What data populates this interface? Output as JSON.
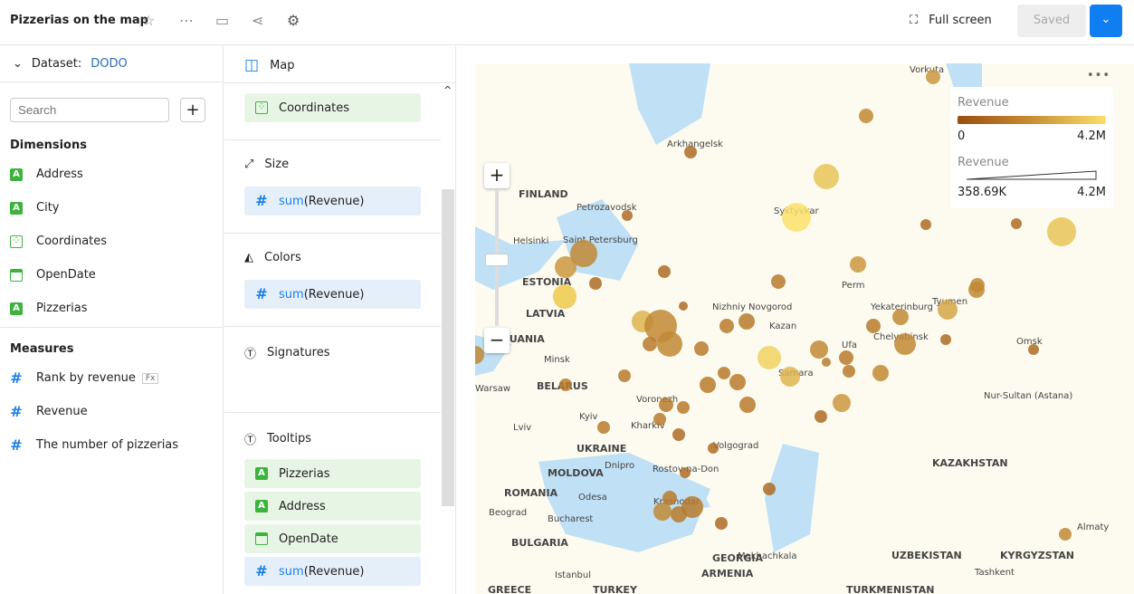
{
  "header": {
    "title": "Pizzerias on the map",
    "fullscreen": "Full screen",
    "saved": "Saved"
  },
  "dataset": {
    "label": "Dataset:",
    "name": "DODO"
  },
  "search": {
    "placeholder": "Search"
  },
  "dimensions": {
    "title": "Dimensions",
    "items": [
      {
        "label": "Address",
        "type": "string"
      },
      {
        "label": "City",
        "type": "string"
      },
      {
        "label": "Coordinates",
        "type": "geo"
      },
      {
        "label": "OpenDate",
        "type": "date"
      },
      {
        "label": "Pizzerias",
        "type": "string"
      }
    ]
  },
  "measures": {
    "title": "Measures",
    "items": [
      {
        "label": "Rank by revenue",
        "type": "number",
        "badge": "Fx"
      },
      {
        "label": "Revenue",
        "type": "number"
      },
      {
        "label": "The number of pizzerias",
        "type": "number"
      }
    ]
  },
  "vis": {
    "type": "Map",
    "coords": "Coordinates",
    "size": "Size",
    "size_fn": "sum",
    "size_field": "(Revenue)",
    "colors": "Colors",
    "colors_fn": "sum",
    "colors_field": "(Revenue)",
    "signatures": "Signatures",
    "tooltips": "Tooltips",
    "tooltip_items": [
      "Pizzerias",
      "Address",
      "OpenDate"
    ],
    "tooltip_fn": "sum",
    "tooltip_field": "(Revenue)"
  },
  "legend": {
    "color_title": "Revenue",
    "color_min": "0",
    "color_max": "4.2M",
    "size_title": "Revenue",
    "size_min": "358.69K",
    "size_max": "4.2M",
    "colors": [
      "#9a4e12",
      "#fbe06a"
    ]
  },
  "map_labels": [
    "Vorkuta",
    "Arkhangelsk",
    "FINLAND",
    "Petrozavodsk",
    "Syktyvkar",
    "Helsinki",
    "Saint Petersburg",
    "ESTONIA",
    "LATVIA",
    "Perm",
    "Nizhniy Novgorod",
    "Yekaterinburg",
    "Tyumen",
    "LITHUANIA",
    "Kazan",
    "Chelyabinsk",
    "Ufa",
    "Omsk",
    "Minsk",
    "BELARUS",
    "Warsaw",
    "Samara",
    "Voronezh",
    "Kyiv",
    "Kharkiv",
    "Lviv",
    "UKRAINE",
    "Volgograd",
    "Dnipro",
    "Rostov-na-Don",
    "MOLDOVA",
    "ROMANIA",
    "Odesa",
    "Krasnodar",
    "Beograd",
    "Bucharest",
    "BULGARIA",
    "Makhachkala",
    "GEORGIA",
    "Istanbul",
    "ARMENIA",
    "TURKEY",
    "GREECE",
    "KAZAKHSTAN",
    "Nur-Sultan (Astana)",
    "UZBEKISTAN",
    "KYRGYZSTAN",
    "Tashkent",
    "TURKMENISTAN",
    "Almaty"
  ]
}
